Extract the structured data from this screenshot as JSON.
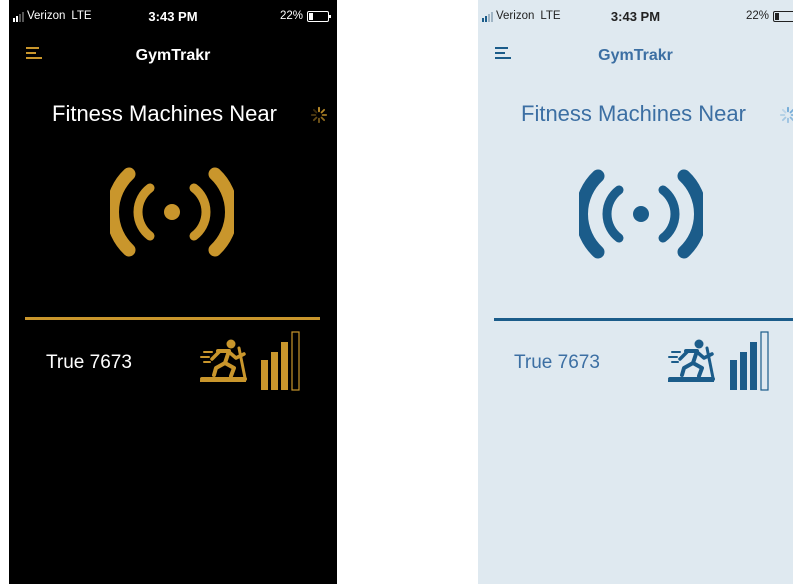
{
  "status": {
    "carrier": "Verizon",
    "network": "LTE",
    "time": "3:43 PM",
    "battery": "22%"
  },
  "app": {
    "title": "GymTrakr",
    "heading": "Fitness Machines Near"
  },
  "machines": [
    {
      "name": "True 7673",
      "icon": "treadmill-runner-icon",
      "signal_bars": 4,
      "signal_filled": 3
    }
  ],
  "themes": {
    "dark": {
      "background": "#000000",
      "accent": "#c9962c",
      "text": "#ffffff"
    },
    "light": {
      "background": "#dfe9f0",
      "accent": "#1b5c8a",
      "text": "#3c6fa3"
    }
  },
  "icons": {
    "menu": "menu-icon",
    "loading": "loading-spinner-icon",
    "broadcast": "broadcast-signal-icon",
    "signal": "signal-strength-icon",
    "battery": "battery-icon"
  }
}
